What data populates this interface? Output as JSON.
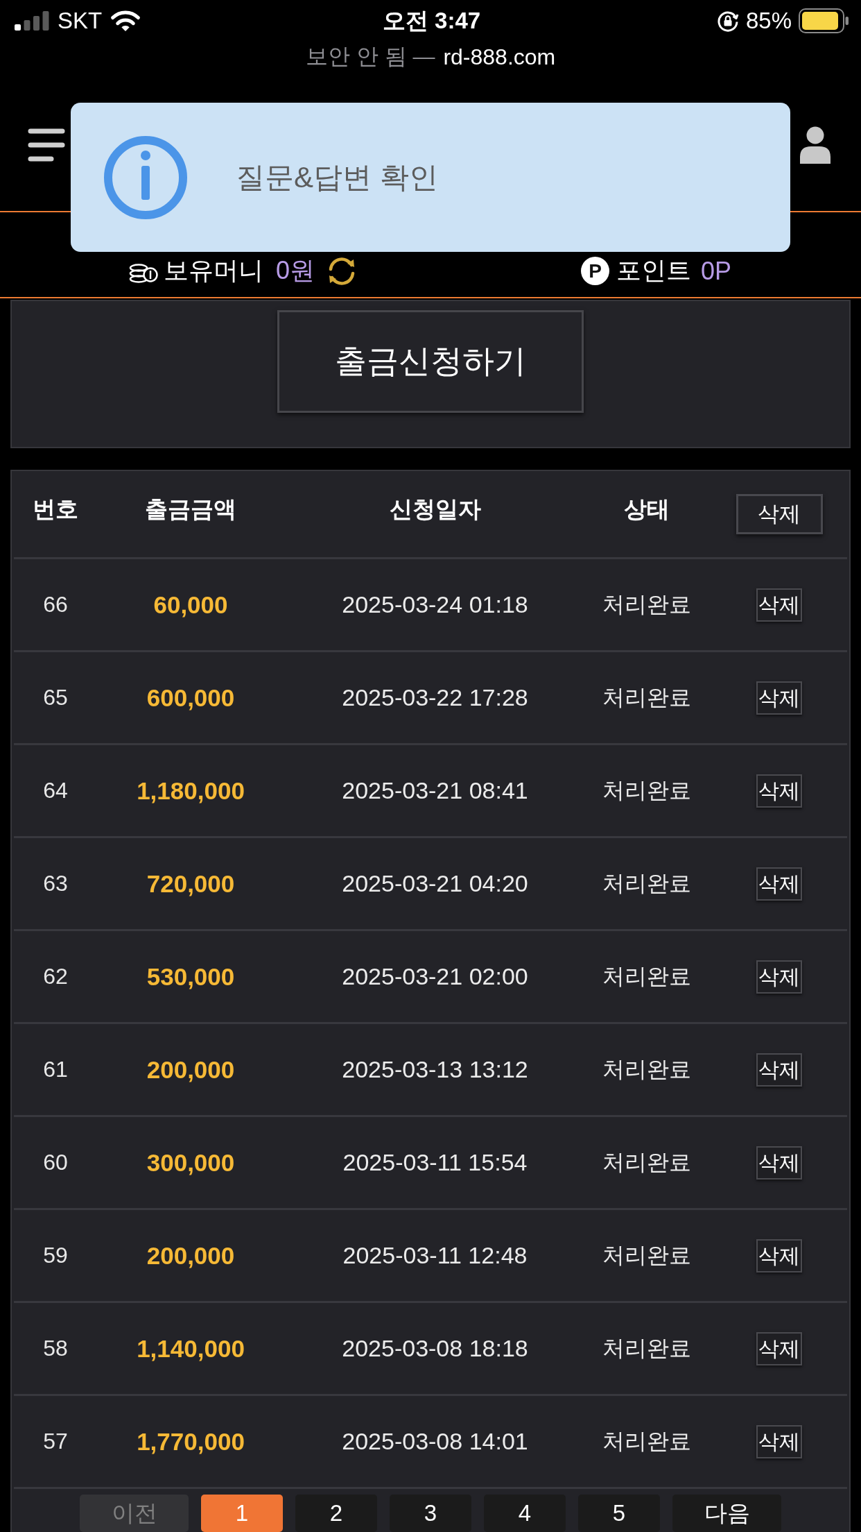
{
  "status_bar": {
    "carrier": "SKT",
    "time": "오전 3:47",
    "battery": "85%"
  },
  "address_bar": {
    "security": "보안 안 됨 —",
    "domain": "rd-888.com"
  },
  "balance_bar": {
    "money_label": "보유머니",
    "money_value": "0원",
    "points_badge": "P",
    "points_label": "포인트",
    "points_value": "0P"
  },
  "toast": {
    "message": "질문&답변 확인"
  },
  "withdraw_panel": {
    "button": "출금신청하기"
  },
  "table": {
    "columns": [
      "번호",
      "출금금액",
      "신청일자",
      "상태"
    ],
    "header_action": "삭제",
    "rows": [
      {
        "no": "66",
        "amount": "60,000",
        "date": "2025-03-24 01:18",
        "status": "처리완료",
        "action": "삭제"
      },
      {
        "no": "65",
        "amount": "600,000",
        "date": "2025-03-22 17:28",
        "status": "처리완료",
        "action": "삭제"
      },
      {
        "no": "64",
        "amount": "1,180,000",
        "date": "2025-03-21 08:41",
        "status": "처리완료",
        "action": "삭제"
      },
      {
        "no": "63",
        "amount": "720,000",
        "date": "2025-03-21 04:20",
        "status": "처리완료",
        "action": "삭제"
      },
      {
        "no": "62",
        "amount": "530,000",
        "date": "2025-03-21 02:00",
        "status": "처리완료",
        "action": "삭제"
      },
      {
        "no": "61",
        "amount": "200,000",
        "date": "2025-03-13 13:12",
        "status": "처리완료",
        "action": "삭제"
      },
      {
        "no": "60",
        "amount": "300,000",
        "date": "2025-03-11 15:54",
        "status": "처리완료",
        "action": "삭제"
      },
      {
        "no": "59",
        "amount": "200,000",
        "date": "2025-03-11 12:48",
        "status": "처리완료",
        "action": "삭제"
      },
      {
        "no": "58",
        "amount": "1,140,000",
        "date": "2025-03-08 18:18",
        "status": "처리완료",
        "action": "삭제"
      },
      {
        "no": "57",
        "amount": "1,770,000",
        "date": "2025-03-08 14:01",
        "status": "처리완료",
        "action": "삭제"
      }
    ]
  },
  "pagination": [
    {
      "kind": "prev",
      "label": "이전",
      "selected": false,
      "disabled": true
    },
    {
      "kind": "page",
      "label": "1",
      "selected": true,
      "disabled": false
    },
    {
      "kind": "page",
      "label": "2",
      "selected": false,
      "disabled": false
    },
    {
      "kind": "page",
      "label": "3",
      "selected": false,
      "disabled": false
    },
    {
      "kind": "page",
      "label": "4",
      "selected": false,
      "disabled": false
    },
    {
      "kind": "page",
      "label": "5",
      "selected": false,
      "disabled": false
    },
    {
      "kind": "next",
      "label": "다음",
      "selected": false,
      "disabled": false
    }
  ]
}
